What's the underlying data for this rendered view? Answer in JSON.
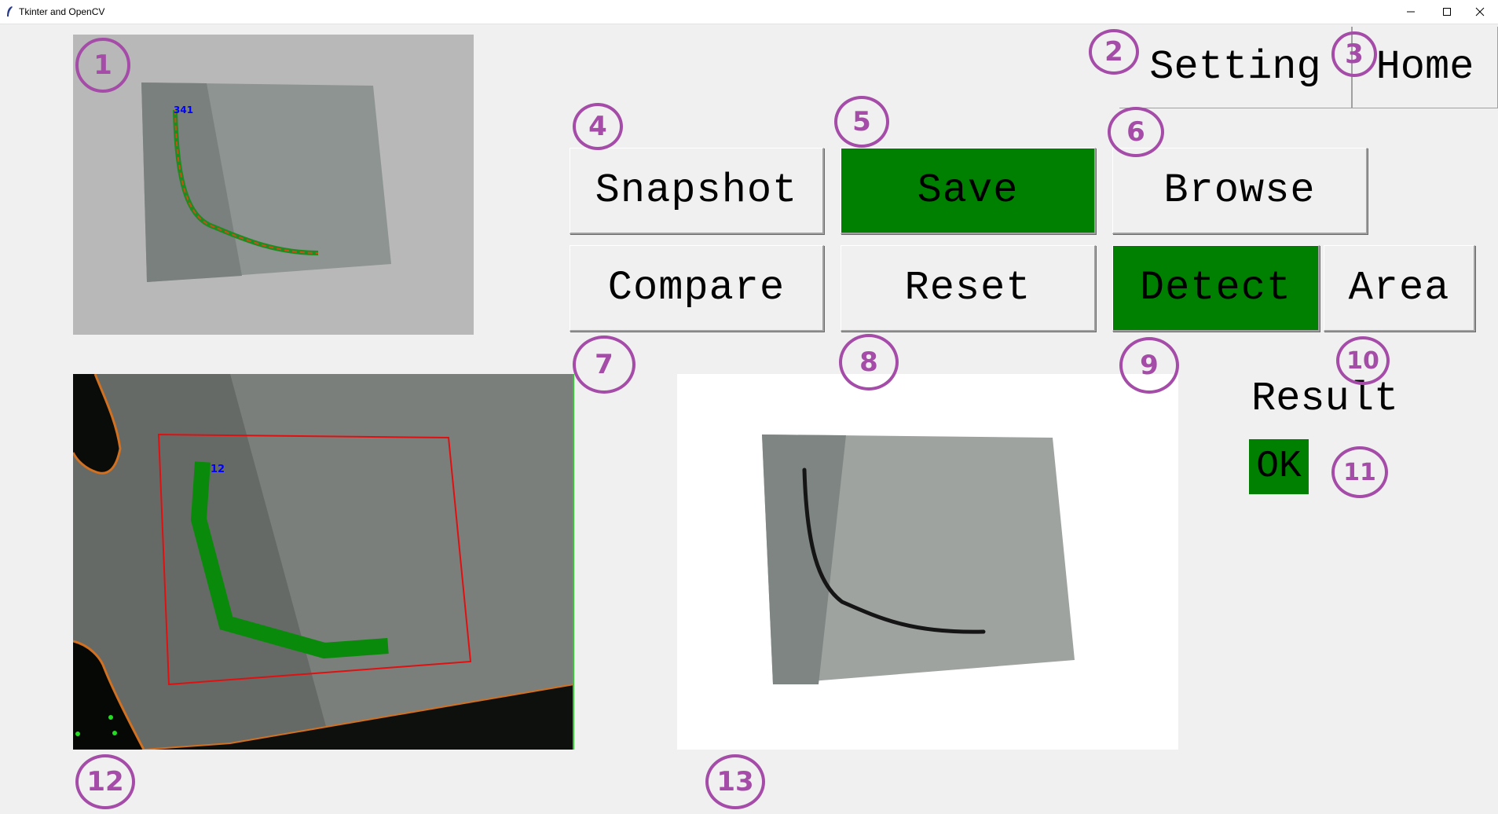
{
  "window": {
    "title": "Tkinter and OpenCV",
    "controls": [
      "minimize-icon",
      "maximize-icon",
      "close-icon"
    ]
  },
  "nav": {
    "setting_label": "Setting",
    "home_label": "Home"
  },
  "buttons": {
    "snapshot": "Snapshot",
    "save": "Save",
    "browse": "Browse",
    "compare": "Compare",
    "reset": "Reset",
    "detect": "Detect",
    "area": "Area"
  },
  "result": {
    "label": "Result",
    "value": "OK"
  },
  "images": {
    "preview_label": "341",
    "detection_label": "12"
  },
  "annotations": [
    "1",
    "2",
    "3",
    "4",
    "5",
    "6",
    "7",
    "8",
    "9",
    "10",
    "11",
    "12",
    "13"
  ],
  "colors": {
    "window_bg": "#f0f0f0",
    "active_green": "#008000",
    "annotation_purple": "#a44ca8"
  }
}
